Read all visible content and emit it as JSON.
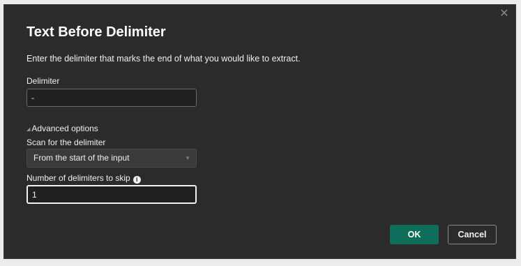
{
  "dialog": {
    "title": "Text Before Delimiter",
    "close_glyph": "✕",
    "description": "Enter the delimiter that marks the end of what you would like to extract."
  },
  "delimiter": {
    "label": "Delimiter",
    "value": "-"
  },
  "advanced": {
    "toggle_glyph": "◢",
    "label": "Advanced options",
    "scan": {
      "label": "Scan for the delimiter",
      "selected": "From the start of the input",
      "arrow_glyph": "▼"
    },
    "skip": {
      "label": "Number of delimiters to skip",
      "info_glyph": "i",
      "value": "1"
    }
  },
  "buttons": {
    "ok": "OK",
    "cancel": "Cancel"
  },
  "colors": {
    "dialog_bg": "#2b2b2b",
    "accent": "#0e6e5a"
  },
  "icons": {
    "close": "close-icon",
    "info": "info-icon",
    "expand": "expand-triangle-icon",
    "dropdown": "chevron-down-icon"
  }
}
